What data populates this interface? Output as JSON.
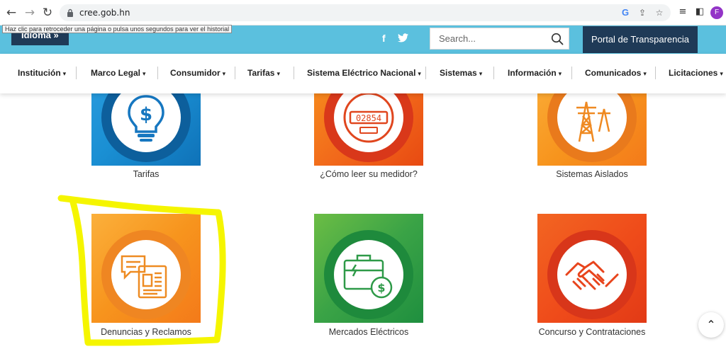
{
  "browser": {
    "url": "cree.gob.hn",
    "back_icon": "back-arrow-icon",
    "forward_icon": "forward-arrow-icon",
    "reload_icon": "reload-icon",
    "avatar_letter": "F",
    "tooltip": "Haz clic para retroceder una página o pulsa unos segundos para ver el historial"
  },
  "header": {
    "idioma_label": "Idioma »",
    "social": {
      "facebook": "f",
      "twitter": "twitter-icon"
    },
    "search": {
      "placeholder": "Search..."
    },
    "portal_label": "Portal de Transparencia"
  },
  "nav": {
    "items": [
      {
        "label": "Institución"
      },
      {
        "label": "Marco Legal"
      },
      {
        "label": "Consumidor"
      },
      {
        "label": "Tarifas"
      },
      {
        "label": "Sistema Eléctrico Nacional"
      },
      {
        "label": "Sistemas"
      },
      {
        "label": "Información"
      },
      {
        "label": "Comunicados"
      },
      {
        "label": "Licitaciones"
      }
    ]
  },
  "tiles": [
    {
      "label": "Tarifas",
      "icon": "lightbulb-dollar-icon"
    },
    {
      "label": "¿Cómo leer su medidor?",
      "icon": "electric-meter-icon",
      "meter_reading": "02854"
    },
    {
      "label": "Sistemas Aislados",
      "icon": "power-tower-icon"
    },
    {
      "label": "Denuncias y Reclamos",
      "icon": "complaint-documents-icon"
    },
    {
      "label": "Mercados Eléctricos",
      "icon": "briefcase-money-icon"
    },
    {
      "label": "Concurso y Contrataciones",
      "icon": "handshake-icon"
    }
  ],
  "colors": {
    "header_bg": "#5bc0de",
    "dark_navy": "#1f3a57",
    "highlight": "#f5f500",
    "blue_tile": "#1a8fd3",
    "orange_tile": "#f58a1f",
    "red_tile": "#ee4a16",
    "green_tile": "#2ea14a"
  }
}
